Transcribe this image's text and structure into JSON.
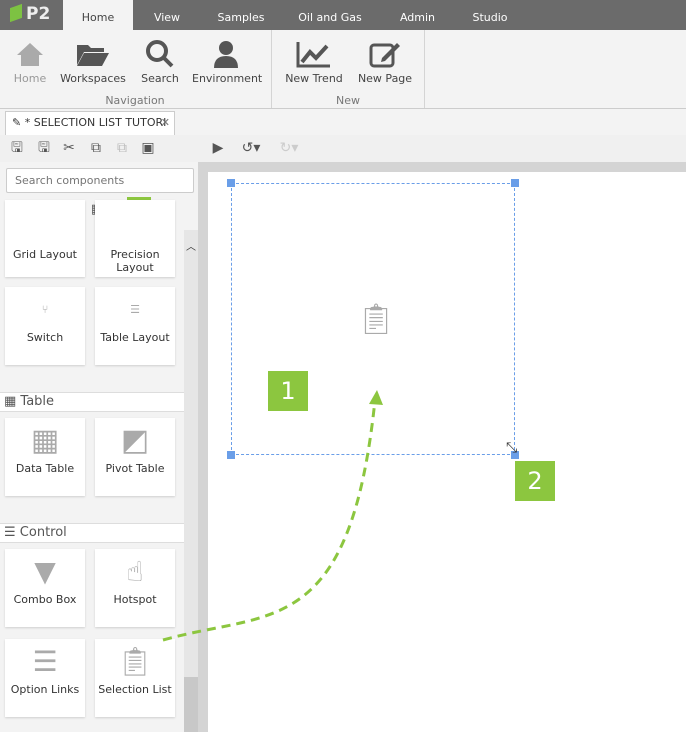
{
  "app": {
    "logo": "P2"
  },
  "tabs": [
    "Home",
    "View",
    "Samples",
    "Oil and Gas",
    "Admin",
    "Studio"
  ],
  "ribbon": {
    "navigation": {
      "label": "Navigation",
      "buttons": [
        "Home",
        "Workspaces",
        "Search",
        "Environment"
      ]
    },
    "new": {
      "label": "New",
      "buttons": [
        "New Trend",
        "New Page"
      ]
    }
  },
  "document_tab": {
    "title": "* SELECTION LIST TUTORI",
    "close": "✕"
  },
  "sidebar": {
    "search_placeholder": "Search components",
    "categories": [
      "hierarchy",
      "area-chart",
      "eye",
      "clock",
      "grid",
      "table",
      "control",
      "cube"
    ],
    "top_cards": [
      "Grid Layout",
      "Precision Layout",
      "Switch",
      "Table Layout"
    ],
    "sections": [
      {
        "title": "Table",
        "cards": [
          "Data Table",
          "Pivot Table"
        ]
      },
      {
        "title": "Control",
        "cards": [
          "Combo Box",
          "Hotspot",
          "Option Links",
          "Selection List"
        ]
      }
    ]
  },
  "annotations": {
    "step1": "1",
    "step2": "2"
  },
  "colors": {
    "accent": "#8cc63f",
    "selection": "#6a9ee8"
  }
}
